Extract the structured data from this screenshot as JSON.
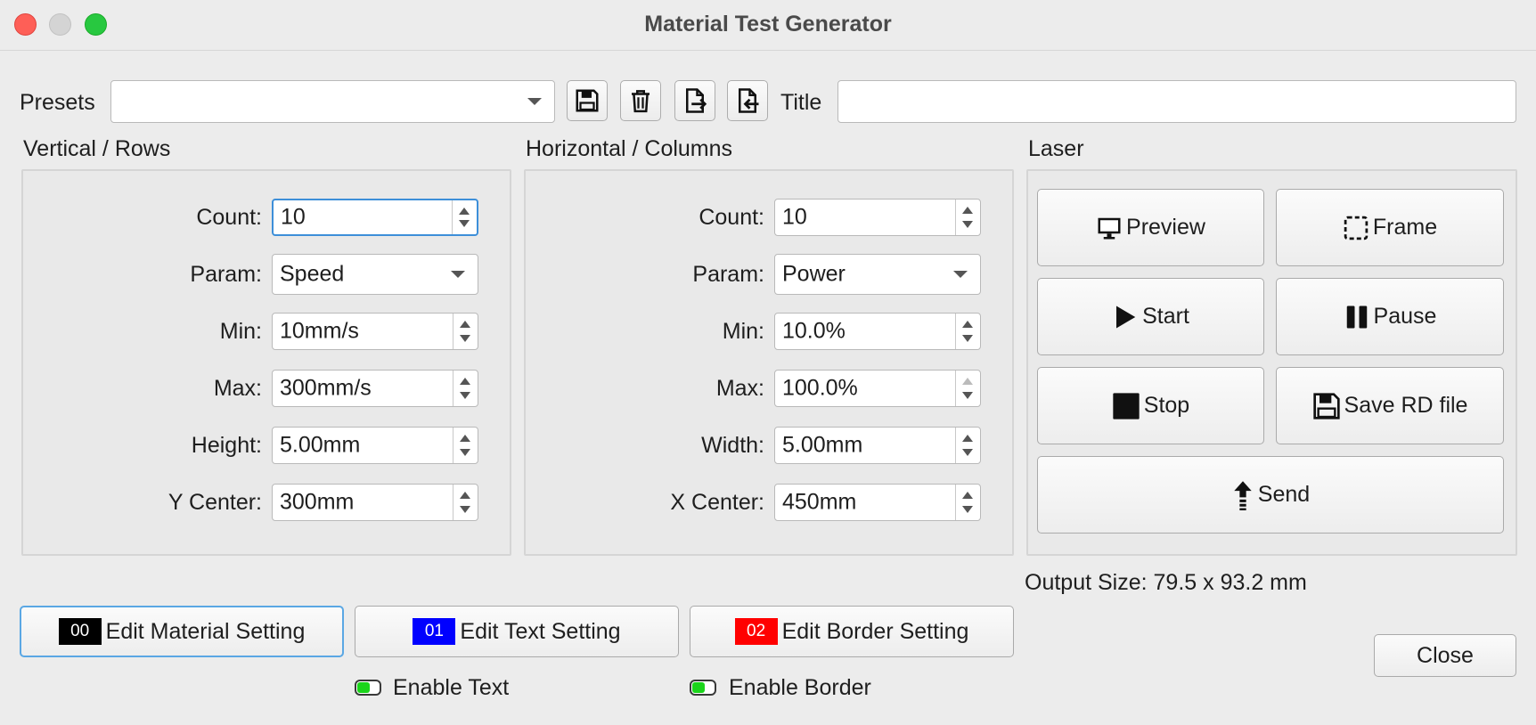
{
  "window": {
    "title": "Material Test Generator"
  },
  "toolbar": {
    "presets_label": "Presets",
    "presets_value": "",
    "title_label": "Title",
    "title_value": ""
  },
  "vertical": {
    "heading": "Vertical / Rows",
    "count_label": "Count:",
    "count_value": "10",
    "param_label": "Param:",
    "param_value": "Speed",
    "min_label": "Min:",
    "min_value": "10mm/s",
    "max_label": "Max:",
    "max_value": "300mm/s",
    "size_label": "Height:",
    "size_value": "5.00mm",
    "center_label": "Y Center:",
    "center_value": "300mm"
  },
  "horizontal": {
    "heading": "Horizontal / Columns",
    "count_label": "Count:",
    "count_value": "10",
    "param_label": "Param:",
    "param_value": "Power",
    "min_label": "Min:",
    "min_value": "10.0%",
    "max_label": "Max:",
    "max_value": "100.0%",
    "size_label": "Width:",
    "size_value": "5.00mm",
    "center_label": "X Center:",
    "center_value": "450mm"
  },
  "laser": {
    "heading": "Laser",
    "preview": "Preview",
    "frame": "Frame",
    "start": "Start",
    "pause": "Pause",
    "stop": "Stop",
    "save_rd": "Save RD file",
    "send": "Send"
  },
  "output_size": "Output Size: 79.5 x 93.2 mm",
  "settings": {
    "material": {
      "code": "00",
      "label": "Edit Material Setting",
      "color": "#000000"
    },
    "text": {
      "code": "01",
      "label": "Edit Text Setting",
      "color": "#0000ff"
    },
    "border": {
      "code": "02",
      "label": "Edit Border Setting",
      "color": "#ff0000"
    }
  },
  "toggles": {
    "enable_text": "Enable Text",
    "enable_border": "Enable Border",
    "on_color": "#1bd41b"
  },
  "close_label": "Close"
}
